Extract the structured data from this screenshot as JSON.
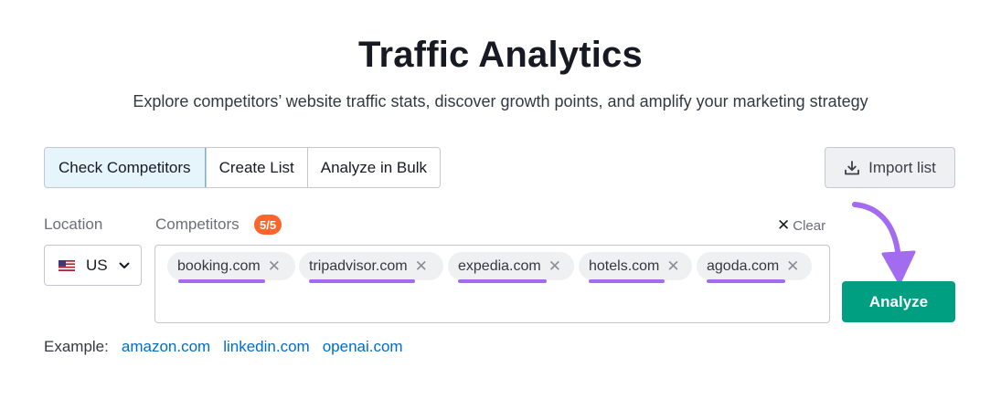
{
  "header": {
    "title": "Traffic Analytics",
    "subtitle": "Explore competitors’ website traffic stats, discover growth points, and amplify your marketing strategy"
  },
  "tabs": [
    {
      "label": "Check Competitors",
      "active": true
    },
    {
      "label": "Create List",
      "active": false
    },
    {
      "label": "Analyze in Bulk",
      "active": false
    }
  ],
  "import_button": {
    "label": "Import list",
    "icon": "download-icon"
  },
  "location": {
    "label": "Location",
    "value": "US",
    "flag": "us-flag-icon"
  },
  "competitors": {
    "label": "Competitors",
    "count": "5/5",
    "clear_label": "Clear",
    "chips": [
      "booking.com",
      "tripadvisor.com",
      "expedia.com",
      "hotels.com",
      "agoda.com"
    ]
  },
  "analyze_button": {
    "label": "Analyze"
  },
  "examples": {
    "label": "Example:",
    "links": [
      "amazon.com",
      "linkedin.com",
      "openai.com"
    ]
  },
  "colors": {
    "accent_green": "#009f81",
    "badge_orange": "#ff642d",
    "annotation_purple": "#a36cf0",
    "link_blue": "#006dca",
    "active_tab_bg": "#e6f4fb"
  }
}
